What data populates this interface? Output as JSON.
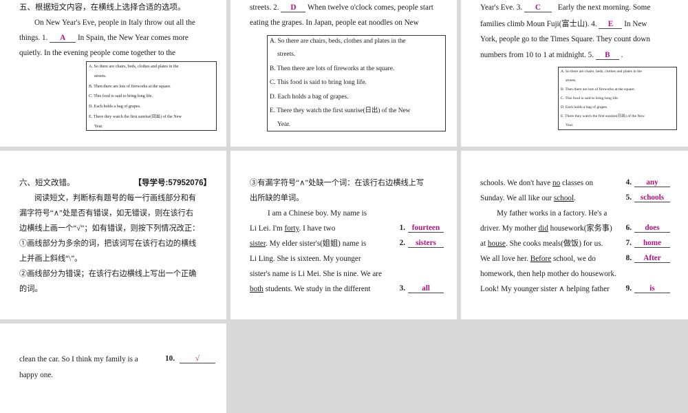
{
  "p1": {
    "heading": "五、根据短文内容，在横线上选择合适的选项。",
    "l1": "On New Year's Eve, people in Italy throw out all the",
    "l2a": "things. 1.",
    "a1": "A",
    "l2b": "In Spain, the New Year comes more",
    "l3": "quietly.  In  the  evening  people  come  together  to  the",
    "opts": [
      "A. So there are chairs, beds, clothes and plates in the",
      "streets.",
      "B. Then there are lots of fireworks at the square.",
      "C. This food is said to bring long life.",
      "D. Each holds a bag of grapes.",
      "E. There they watch the first sunrise(日出) of the New",
      "Year."
    ]
  },
  "p2": {
    "l1a": "streets. 2.",
    "a2": "D",
    "l1b": "When twelve o'clock comes, people start",
    "l2": "eating the grapes. In Japan, people eat noodles on New",
    "opts": [
      "A. So there are chairs, beds, clothes and plates in the",
      "streets.",
      "B. Then there are lots of fireworks at the square.",
      "C. This food is said to bring long life.",
      "D. Each holds a bag of grapes.",
      "E. There they watch the first sunrise(日出) of the New",
      "Year."
    ]
  },
  "p3": {
    "l1a": "Year's Eve. 3.",
    "a3": "C",
    "l1b": "Early the next morning. Some",
    "l2a": "families climb Moun Fuji(富士山). 4.",
    "a4": "E",
    "l2b": "In New",
    "l3": "York, people go to the Times Square. They count down",
    "l4a": "numbers from 10 to 1 at midnight. 5.",
    "a5": "B",
    "l4b": ".",
    "opts": [
      "A. So there are chairs, beds, clothes and plates in the",
      "streets.",
      "B. Then there are lots of fireworks at the square.",
      "C. This food is said to bring long life.",
      "D. Each holds a bag of grapes.",
      "E. There they watch the first sunrise(日出) of the New",
      "Year."
    ]
  },
  "p4": {
    "heading": "六、短文改错。",
    "guide": "【导学号:57952076】",
    "lines": [
      "阅读短文，判断标有题号的每一行画线部分和有",
      "漏字符号“∧”处是否有错误，如无错误，则在该行右",
      "边横线上画一个“√”；如有错误，则按下列情况改正：",
      "①画线部分为多余的词，把该词写在该行右边的横线",
      "上并画上斜线“\\”。",
      "②画线部分为错误；在该行右边横线上写出一个正确",
      "的词。"
    ]
  },
  "p5": {
    "rule1": "③有漏字符号“∧”处缺一个词：在该行右边横线上写",
    "rule2": "出所缺的单词。",
    "t1": "I am a Chinese boy. My name is",
    "t2a": "Li Lei. I'm ",
    "t2u": "forty",
    "t2b": ".  I have two",
    "t3u": "sister",
    "t3b": ". My elder sister's(姐姐) name is",
    "t4": "Li Ling. She is sixteen. My younger",
    "t5": "sister's name is Li Mei. She is nine. We are",
    "t6u": "both",
    "t6b": " students. We study in the different",
    "answers": [
      {
        "n": "1.",
        "v": "fourteen"
      },
      {
        "n": "2.",
        "v": "sisters"
      },
      {
        "n": "3.",
        "v": "all"
      }
    ]
  },
  "p6": {
    "t1a": "schools. We don't have ",
    "t1u": "no",
    "t1b": " classes on",
    "t2a": "Sunday. We all like our ",
    "t2u": "school",
    "t2b": ".",
    "t3": "My father works in a factory. He's a",
    "t4a": "driver. My mother ",
    "t4u": "did",
    "t4b": " housework(家务事)",
    "t5a": "at ",
    "t5u": "house",
    "t5b": ". She cooks meals(做饭) for us.",
    "t6a": "We all love her. ",
    "t6u": "Before",
    "t6b": " school, we do",
    "t7": "homework, then help mother do housework.",
    "t8": "Look!  My younger sister  ∧  helping father",
    "answers": [
      {
        "n": "4.",
        "v": "any"
      },
      {
        "n": "5.",
        "v": "schools"
      },
      {
        "n": "6.",
        "v": "does"
      },
      {
        "n": "7.",
        "v": "home"
      },
      {
        "n": "8.",
        "v": "After"
      },
      {
        "n": "9.",
        "v": "is"
      }
    ]
  },
  "p7": {
    "t1": "clean the car. So I think my family is a",
    "n10": "10.",
    "a10": "√",
    "t2": "happy one."
  }
}
